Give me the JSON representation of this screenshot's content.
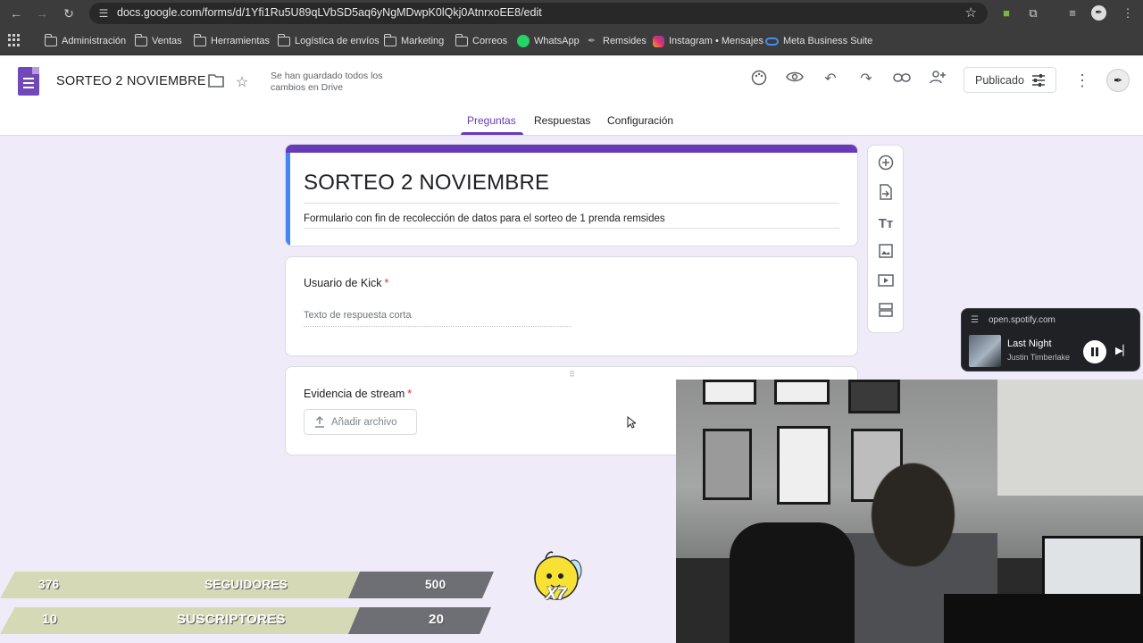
{
  "browser": {
    "url": "docs.google.com/forms/d/1Yfi1Ru5U89qLVbSD5aq6yNgMDwpK0lQkj0AtnrxoEE8/edit",
    "bookmarks": [
      {
        "label": "Administración",
        "icon": "folder-icon"
      },
      {
        "label": "Ventas",
        "icon": "folder-icon"
      },
      {
        "label": "Herramientas",
        "icon": "folder-icon"
      },
      {
        "label": "Logística de envíos",
        "icon": "folder-icon"
      },
      {
        "label": "Marketing",
        "icon": "folder-icon"
      },
      {
        "label": "Correos",
        "icon": "folder-icon"
      },
      {
        "label": "WhatsApp",
        "icon": "whatsapp-icon"
      },
      {
        "label": "Remsides",
        "icon": "remsides-icon"
      },
      {
        "label": "Instagram • Mensajes",
        "icon": "instagram-icon"
      },
      {
        "label": "Meta Business Suite",
        "icon": "meta-icon"
      }
    ]
  },
  "header": {
    "doc_title": "SORTEO 2 NOVIEMBRE",
    "save_status": "Se han guardado todos los cambios en Drive",
    "publish_label": "Publicado",
    "avatar_text": "✒"
  },
  "tabs": [
    {
      "label": "Preguntas",
      "active": true
    },
    {
      "label": "Respuestas",
      "active": false
    },
    {
      "label": "Configuración",
      "active": false
    }
  ],
  "form": {
    "title": "SORTEO 2 NOVIEMBRE",
    "description": "Formulario con fin de recolección de datos para el sorteo de 1 prenda remsides",
    "questions": [
      {
        "title": "Usuario de Kick",
        "required": "*",
        "placeholder": "Texto de respuesta corta"
      },
      {
        "title": "Evidencia de stream",
        "required": "*",
        "button": "Añadir archivo"
      }
    ]
  },
  "spotify": {
    "source": "open.spotify.com",
    "song": "Last Night",
    "artist": "Justin Timberlake"
  },
  "overlay": {
    "followers": {
      "current": "376",
      "label": "SEGUIDORES",
      "goal": "500"
    },
    "subscribers": {
      "current": "10",
      "label": "SUSCRIPTORES",
      "goal": "20"
    },
    "badge": "X7"
  },
  "colors": {
    "form_accent": "#673ab7",
    "page_bg": "#f0ebf8",
    "required": "#d93025"
  }
}
